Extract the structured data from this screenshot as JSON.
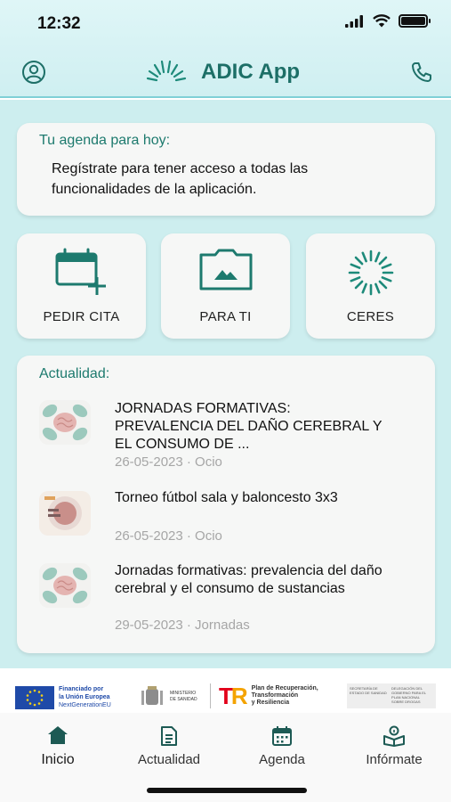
{
  "status_bar": {
    "time": "12:32"
  },
  "header": {
    "title": "ADIC App",
    "profile_icon": "user-circle-icon",
    "phone_icon": "phone-icon"
  },
  "agenda": {
    "title": "Tu agenda para hoy:",
    "message": "Regístrate para tener acceso a todas las funcionalidades de la aplicación."
  },
  "tiles": [
    {
      "label": "PEDIR CITA",
      "icon": "calendar-add-icon"
    },
    {
      "label": "PARA TI",
      "icon": "image-icon"
    },
    {
      "label": "CERES",
      "icon": "ceres-burst-icon"
    }
  ],
  "news": {
    "title": "Actualidad:",
    "items": [
      {
        "title": "JORNADAS FORMATIVAS: PREVALENCIA DEL DAÑO CEREBRAL Y EL CONSUMO DE ...",
        "meta": "26-05-2023 · Ocio"
      },
      {
        "title": "Torneo fútbol sala y baloncesto 3x3",
        "meta": "26-05-2023 · Ocio"
      },
      {
        "title": "Jornadas formativas: prevalencia del daño cerebral y el consumo de sustancias",
        "meta": "29-05-2023 · Jornadas"
      }
    ]
  },
  "sponsors": {
    "eu_line1": "Financiado por",
    "eu_line2": "la Unión Europea",
    "eu_line3": "NextGenerationEU",
    "ministry_line1": "MINISTERIO",
    "ministry_line2": "DE SANIDAD",
    "plan_line1": "Plan de Recuperación,",
    "plan_line2": "Transformación",
    "plan_line3": "y Resiliencia",
    "secretaria": "SECRETARÍA DE ESTADO DE SANIDAD",
    "delegacion": "DELEGACIÓN DEL GOBIERNO PARA EL PLAN NACIONAL SOBRE DROGAS"
  },
  "bottom_nav": [
    {
      "label": "Inicio",
      "icon": "home-icon"
    },
    {
      "label": "Actualidad",
      "icon": "document-icon"
    },
    {
      "label": "Agenda",
      "icon": "calendar-icon"
    },
    {
      "label": "Infórmate",
      "icon": "info-book-icon"
    }
  ],
  "colors": {
    "accent": "#1d7a6e",
    "background": "#cdeeef",
    "header": "#dff6f7"
  }
}
